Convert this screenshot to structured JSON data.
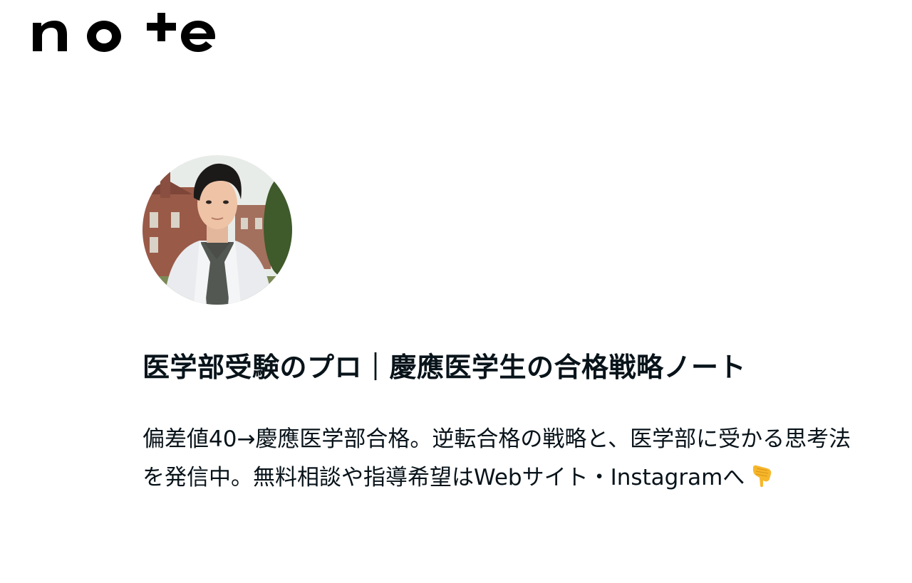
{
  "header": {
    "logo_text": "note",
    "logo_icon": "note-logo"
  },
  "profile": {
    "avatar_icon": "profile-avatar-photo",
    "name": "医学部受験のプロ｜慶應医学生の合格戦略ノート",
    "bio": "偏差値40→慶應医学部合格。逆転合格の戦略と、医学部に受かる思考法を発信中。無料相談や指導希望はWebサイト・Instagramへ",
    "bio_emoji_icon": "pointing-down-hand-emoji"
  },
  "colors": {
    "text": "#08131a",
    "background": "#ffffff"
  }
}
